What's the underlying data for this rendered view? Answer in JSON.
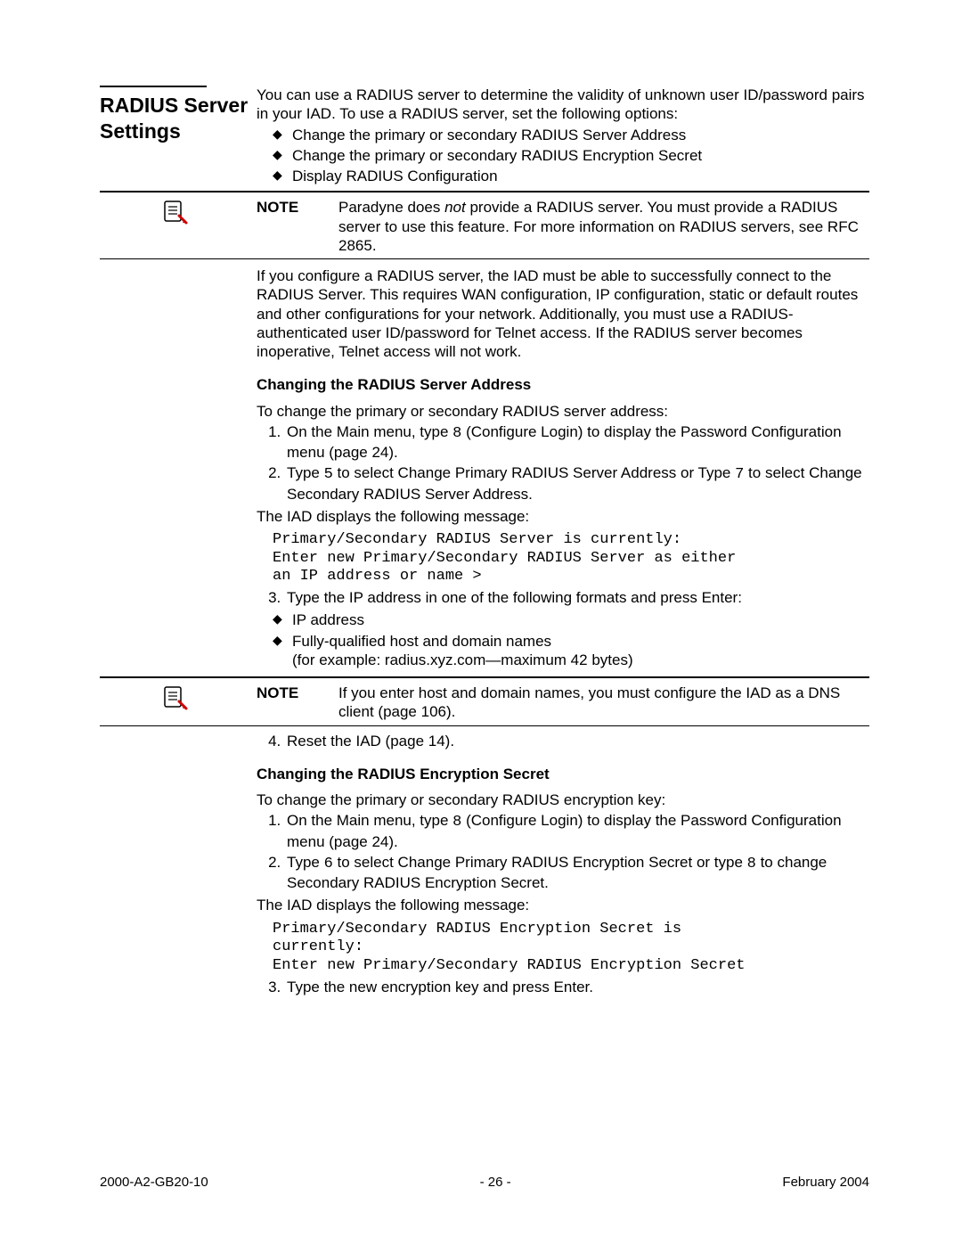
{
  "section_title": "RADIUS Server Settings",
  "intro": "You can use a RADIUS server to determine the validity of unknown user ID/password pairs in your IAD. To use a RADIUS server, set the following options:",
  "intro_bullets": [
    "Change the primary or secondary RADIUS Server Address",
    "Change the primary or secondary RADIUS Encryption Secret",
    "Display RADIUS Configuration"
  ],
  "note1_label": "NOTE",
  "note1_pre": "Paradyne does ",
  "note1_not": "not",
  "note1_post": " provide a RADIUS server. You must provide a RADIUS server to use this feature. For more information on RADIUS servers, see RFC 2865.",
  "para2": "If you configure a RADIUS server, the IAD must be able to successfully connect to the RADIUS Server. This requires WAN configuration, IP configuration, static or default routes and other configurations for your network. Additionally, you must use a RADIUS-authenticated user ID/password for Telnet access. If the RADIUS server becomes inoperative, Telnet access will not work.",
  "sub1_title": "Changing the RADIUS Server Address",
  "sub1_intro": "To change the primary or secondary RADIUS server address:",
  "sub1_step1_a": "On the Main menu, type ",
  "sub1_step1_code": "8",
  "sub1_step1_b": " (Configure Login) to display the Password Configuration menu (page 24).",
  "sub1_step2_a": "Type ",
  "sub1_step2_code1": "5",
  "sub1_step2_b": " to select Change Primary RADIUS Server Address or Type ",
  "sub1_step2_code2": "7",
  "sub1_step2_c": " to select Change Secondary RADIUS Server Address.",
  "sub1_msg_intro": "The IAD displays the following message:",
  "sub1_mono": "Primary/Secondary RADIUS Server is currently:\nEnter new Primary/Secondary RADIUS Server as either\nan IP address or name >",
  "sub1_step3": "Type the IP address in one of the following formats and press Enter:",
  "sub1_bullets": [
    " IP address",
    " Fully-qualified host and domain names"
  ],
  "sub1_bullets_extra": "(for example: radius.xyz.com—maximum 42 bytes)",
  "note2_label": "NOTE",
  "note2_text": "If you enter host and domain names, you must configure the IAD as a DNS client (page 106).",
  "sub1_step4": "Reset the IAD (page 14).",
  "sub2_title": "Changing the RADIUS Encryption Secret",
  "sub2_intro": "To change the primary or secondary RADIUS encryption key:",
  "sub2_step1_a": "On the Main menu, type ",
  "sub2_step1_code": "8",
  "sub2_step1_b": " (Configure Login) to display the Password Configuration menu (page 24).",
  "sub2_step2_a": "Type ",
  "sub2_step2_code1": "6",
  "sub2_step2_b": " to select Change Primary RADIUS Encryption Secret or type ",
  "sub2_step2_code2": "8",
  "sub2_step2_c": " to change Secondary RADIUS Encryption Secret.",
  "sub2_msg_intro": "The IAD displays the following message:",
  "sub2_mono": "Primary/Secondary RADIUS Encryption Secret is\ncurrently:\nEnter new Primary/Secondary RADIUS Encryption Secret",
  "sub2_step3": "Type the new encryption key and press Enter.",
  "footer_left": "2000-A2-GB20-10",
  "footer_center": "- 26 -",
  "footer_right": "February 2004"
}
